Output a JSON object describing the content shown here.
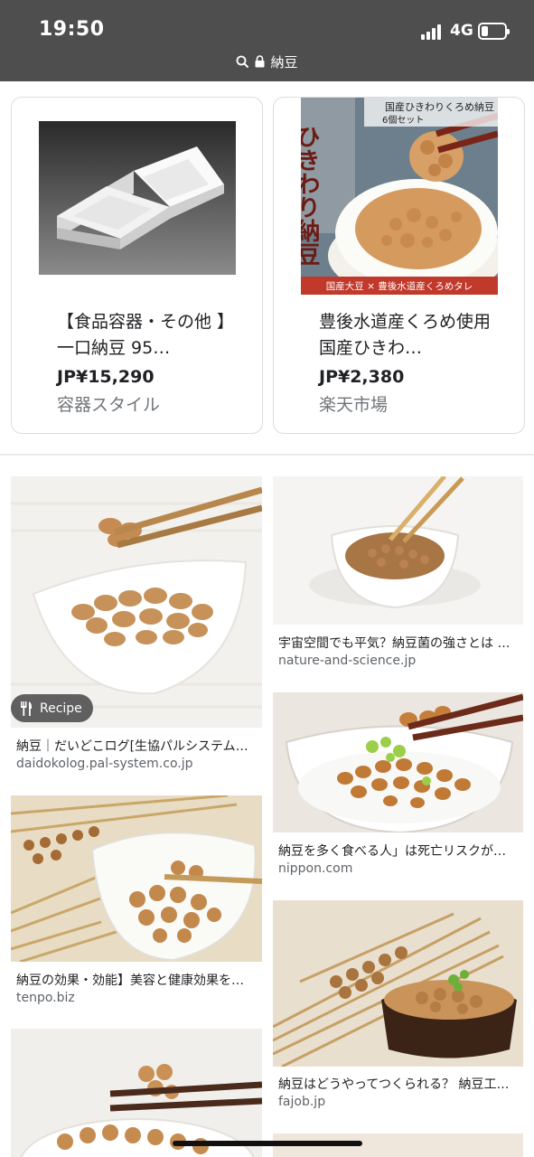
{
  "status_bar": {
    "time": "19:50",
    "network": "4G",
    "battery_percent": 20
  },
  "url_bar": {
    "query": "納豆",
    "icons": [
      "search-icon",
      "lock-icon"
    ]
  },
  "shopping": [
    {
      "title": "【食品容器・その他 】一口納豆 95…",
      "price": "JP¥15,290",
      "seller": "容器スタイル"
    },
    {
      "title": "豊後水道産くろめ使用 国産ひきわ…",
      "price": "JP¥2,380",
      "seller": "楽天市場",
      "image_text": {
        "top": "国産ひきわりくろめ納豆",
        "sub": "6個セット",
        "side": "ひきわり納豆",
        "bottom": "国産大豆 × 豊後水道産くろめタレ"
      }
    }
  ],
  "results": {
    "left": [
      {
        "caption": "納豆｜だいどこログ[生協パルシステム…",
        "domain": "daidokolog.pal-system.co.jp",
        "badge": "Recipe"
      },
      {
        "caption": "納豆の効果・効能】美容と健康効果を…",
        "domain": "tenpo.biz"
      }
    ],
    "right": [
      {
        "caption": "宇宙空間でも平気？納豆菌の強さとは …",
        "domain": "nature-and-science.jp"
      },
      {
        "caption": "納豆を多く食べる人」は死亡リスクが…",
        "domain": "nippon.com"
      },
      {
        "caption": "納豆はどうやってつくられる？ 納豆工…",
        "domain": "fajob.jp"
      }
    ]
  },
  "colors": {
    "status_bar_bg": "#4e4e4e",
    "card_border": "#dadce0",
    "domain_text": "#5f6368",
    "seller_text": "#70757a"
  }
}
